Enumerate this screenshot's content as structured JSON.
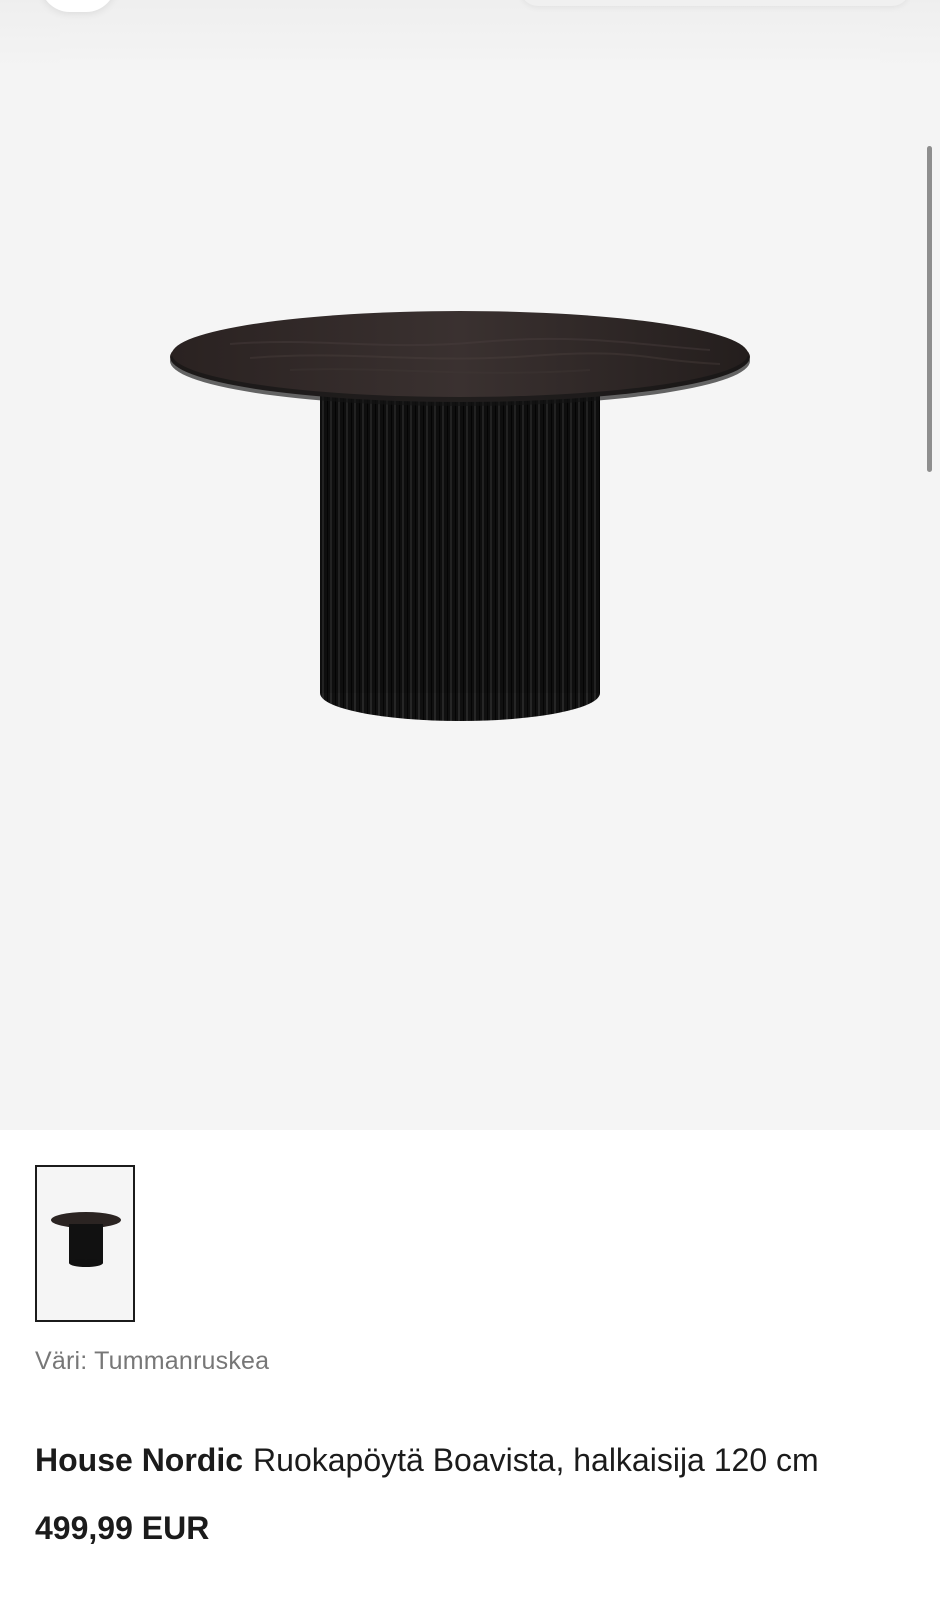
{
  "product": {
    "brand": "House Nordic",
    "name": "Ruokapöytä Boavista, halkaisija 120 cm",
    "price": "499,99 EUR",
    "color_label": "Väri: Tummanruskea"
  },
  "colors": {
    "gallery_background": "#f4f4f4",
    "text": "#1b1b1b",
    "muted_text": "#777777",
    "table_top": "#2b2422",
    "table_base": "#111111"
  },
  "icons": {
    "main_image": "round-dining-table-image",
    "thumbnail": "round-dining-table-thumbnail"
  }
}
